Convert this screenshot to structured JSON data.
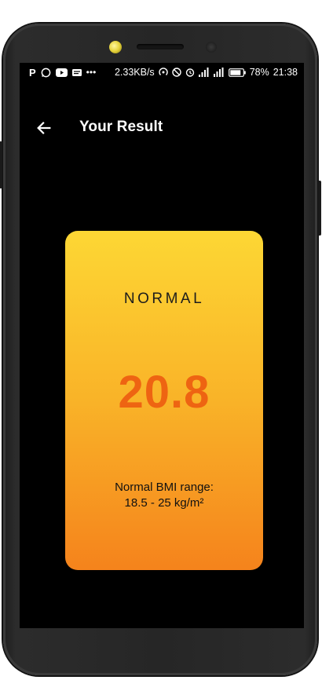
{
  "statusbar": {
    "left_icons": [
      "p-app-icon",
      "whatsapp-icon",
      "youtube-icon",
      "message-icon",
      "more-dots-icon"
    ],
    "net_speed": "2.33KB/s",
    "right_icons": [
      "hotspot-icon",
      "no-disturb-icon",
      "alarm-icon",
      "signal-icon",
      "4g-signal-icon",
      "battery-icon"
    ],
    "battery": "78%",
    "time": "21:38"
  },
  "appbar": {
    "title": "Your Result"
  },
  "result": {
    "status": "NORMAL",
    "bmi": "20.8",
    "range_label": "Normal BMI range:",
    "range_value": "18.5 - 25 kg/m²"
  },
  "colors": {
    "card_top": "#fdd734",
    "card_bottom": "#f5831c",
    "bmi_value": "#ee6412",
    "background": "#000000"
  }
}
